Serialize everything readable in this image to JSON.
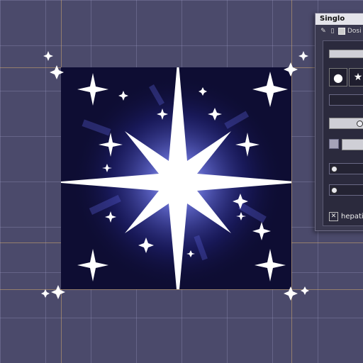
{
  "panel": {
    "title": "Singlo",
    "tools": [
      {
        "icon": "brush-icon",
        "glyph": "✎"
      },
      {
        "icon": "layers-icon",
        "glyph": "▯"
      },
      {
        "icon": "square-icon",
        "glyph": ""
      }
    ],
    "mode_label": "Dosi",
    "shape_options": [
      {
        "icon": "circle-icon",
        "glyph": "●"
      },
      {
        "icon": "star-icon",
        "glyph": "★"
      }
    ],
    "footer_label": "hepati",
    "footer_icon": "close-box-icon"
  },
  "colors": {
    "canvas_bg": "#4b4a6b",
    "artboard_bg": "#0e0d33",
    "star_glow": "#3b3fbf",
    "star": "#ffffff"
  }
}
